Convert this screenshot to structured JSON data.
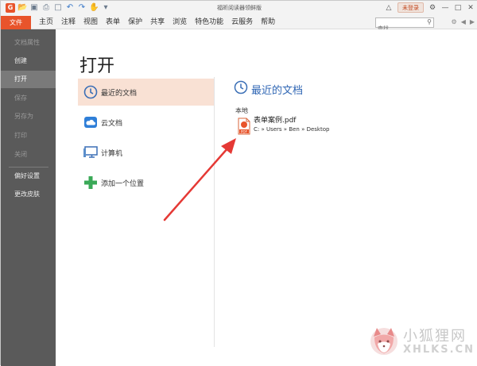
{
  "window": {
    "title": "福昕阅读器领鲜版"
  },
  "titlebar": {
    "quick_icons": [
      "app-logo-icon",
      "open-icon",
      "save-icon",
      "print-icon",
      "screenshot-icon",
      "undo-icon",
      "redo-icon",
      "hand-tool-icon",
      "dropdown-icon"
    ],
    "login_label": "未登录"
  },
  "menubar": {
    "file_tab": "文件",
    "menus": [
      "主页",
      "注释",
      "视图",
      "表单",
      "保护",
      "共享",
      "浏览",
      "特色功能",
      "云服务",
      "帮助"
    ],
    "search_placeholder": "查找"
  },
  "sidebar": {
    "items": [
      {
        "label": "文档属性",
        "state": "disabled"
      },
      {
        "label": "创建",
        "state": "normal"
      },
      {
        "label": "打开",
        "state": "active"
      },
      {
        "label": "保存",
        "state": "disabled"
      },
      {
        "label": "另存为",
        "state": "disabled"
      },
      {
        "label": "打印",
        "state": "disabled"
      },
      {
        "label": "关闭",
        "state": "disabled"
      },
      {
        "label": "偏好设置",
        "state": "normal"
      },
      {
        "label": "更改皮肤",
        "state": "normal"
      }
    ]
  },
  "main": {
    "title": "打开",
    "locations": [
      {
        "label": "最近的文档",
        "icon": "clock-icon"
      },
      {
        "label": "云文档",
        "icon": "cloud-icon"
      },
      {
        "label": "计算机",
        "icon": "computer-icon"
      },
      {
        "label": "添加一个位置",
        "icon": "plus-icon"
      }
    ],
    "recent": {
      "heading": "最近的文档",
      "section": "本地",
      "file_name": "表单案例.pdf",
      "file_path": "C: » Users » Ben » Desktop",
      "pdf_badge": "PDF"
    }
  },
  "watermark": {
    "cn": "小狐狸网",
    "en": "XHLKS.CN"
  },
  "colors": {
    "accent": "#e8542b",
    "sidebar": "#5a5a5a",
    "active_bg": "#f9e1d4",
    "link_blue": "#2f66b4",
    "arrow": "#e53935"
  }
}
